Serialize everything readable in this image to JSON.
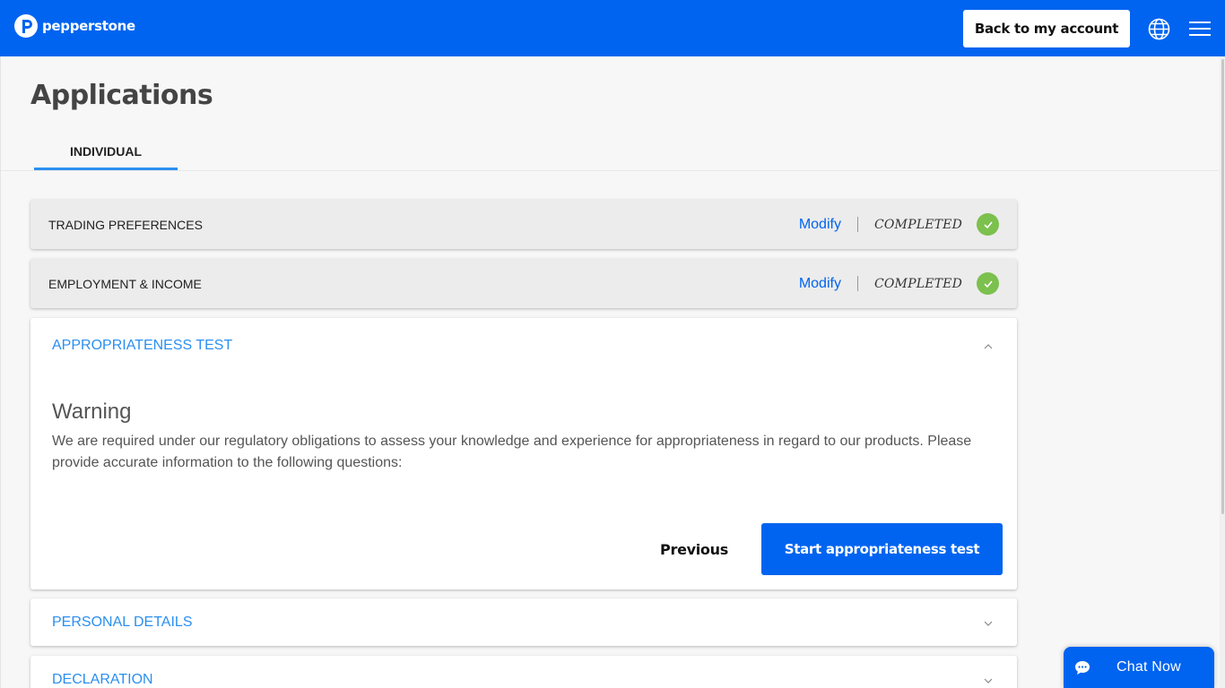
{
  "header": {
    "logo_text": "pepperstone",
    "back_label": "Back to my account",
    "brand_color": "#0064f0"
  },
  "page": {
    "title": "Applications",
    "tab_label": "INDIVIDUAL"
  },
  "sections": {
    "trading": {
      "title": "TRADING PREFERENCES",
      "action": "Modify",
      "status": "COMPLETED"
    },
    "employment": {
      "title": "EMPLOYMENT & INCOME",
      "action": "Modify",
      "status": "COMPLETED"
    },
    "appropriateness": {
      "title": "APPROPRIATENESS TEST",
      "warning_title": "Warning",
      "warning_text": "We are required under our regulatory obligations to assess your knowledge and experience for appropriateness in regard to our products. Please provide accurate information to the following questions:",
      "previous_label": "Previous",
      "start_label": "Start appropriateness test"
    },
    "personal": {
      "title": "PERSONAL DETAILS"
    },
    "declaration": {
      "title": "DECLARATION"
    }
  },
  "chat": {
    "label": "Chat Now"
  },
  "icons": {
    "globe": "globe-icon",
    "menu": "hamburger-menu-icon",
    "check": "check-icon",
    "chevron_up": "chevron-up-icon",
    "chevron_down": "chevron-down-icon",
    "chat": "chat-bubble-icon"
  },
  "colors": {
    "status_green": "#7cc04e",
    "section_blue": "#2b8ff0"
  }
}
